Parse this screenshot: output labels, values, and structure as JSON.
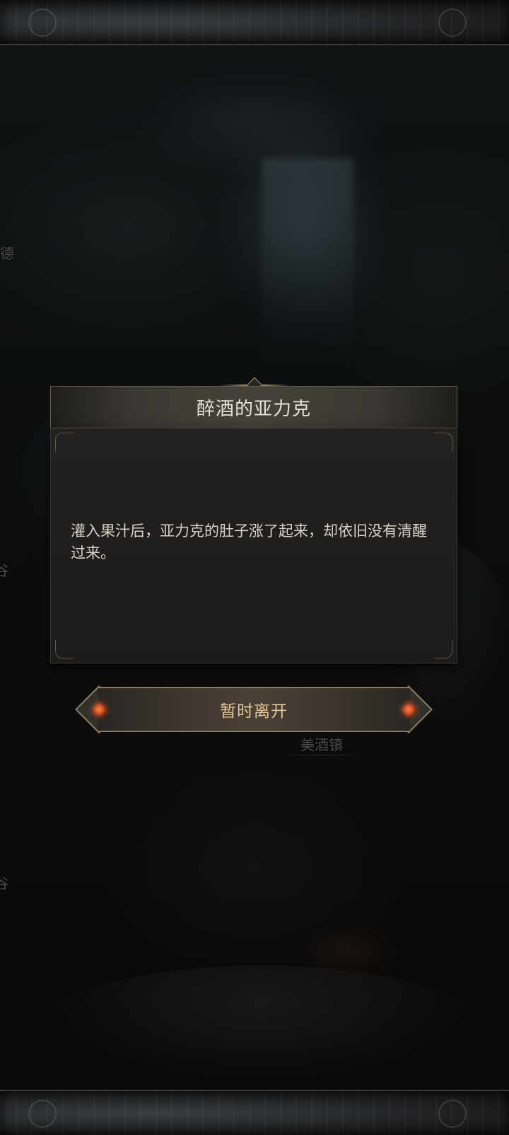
{
  "dialog": {
    "title": "醉酒的亚力克",
    "text": "灌入果汁后，亚力克的肚子涨了起来，却依旧没有清醒过来。"
  },
  "leave_button": {
    "label": "暂时离开"
  },
  "map": {
    "labels": {
      "left_top": "德",
      "left_mid": "谷",
      "left_low": "谷",
      "town": "美酒镇"
    }
  },
  "colors": {
    "title_text": "#e9e3d4",
    "body_text": "#d6d1c6",
    "button_text": "#e6c894",
    "gold_trim": "#8c7a5c",
    "jewel": "#c8461e"
  }
}
